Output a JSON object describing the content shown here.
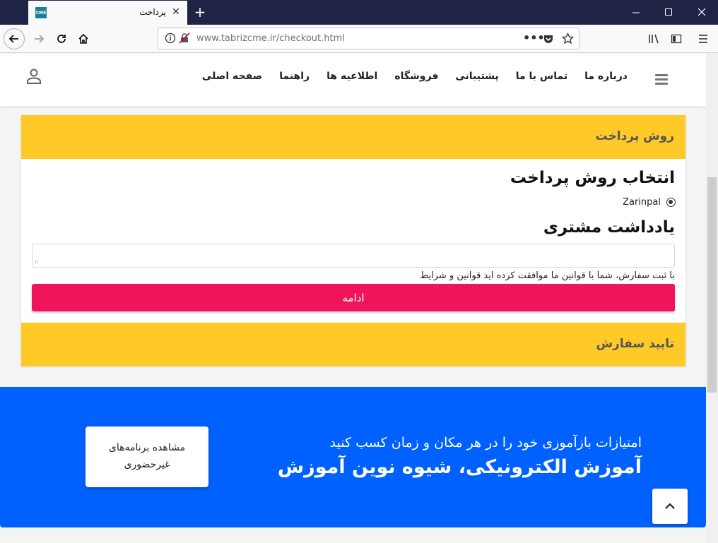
{
  "browser": {
    "tab_title": "پرداخت",
    "favicon_text": "CME",
    "url_host": "www.tabrizcme.ir",
    "url_path": "/checkout.html"
  },
  "site_menu": {
    "items": [
      "صفحه اصلی",
      "راهنما",
      "اطلاعیه ها",
      "فروشگاه",
      "پشتیبانی",
      "تماس با ما",
      "درباره ما"
    ]
  },
  "checkout": {
    "payment_method_header": "روش پرداخت",
    "select_payment_heading": "انتخاب روش پرداخت",
    "payment_option": "Zarinpal",
    "customer_note_heading": "یادداشت مشتری",
    "terms_text": "با ثبت سفارش، شما با قوانین ما موافقت کرده اید قوانین و شرایط",
    "continue_label": "ادامه",
    "confirm_order_header": "تایید سفارش"
  },
  "banner": {
    "line1": "امتیازات بازآموزی خود را در هر مکان و زمان کسب کنید",
    "line2": "آموزش الکترونیکی، شیوه نوین آموزش",
    "button_label": "مشاهده برنامه‌های غیرحضوری"
  },
  "colors": {
    "accent_yellow": "#ffca28",
    "continue_pink": "#f0145a",
    "banner_blue": "#0061ff",
    "titlebar": "#1f2447"
  }
}
